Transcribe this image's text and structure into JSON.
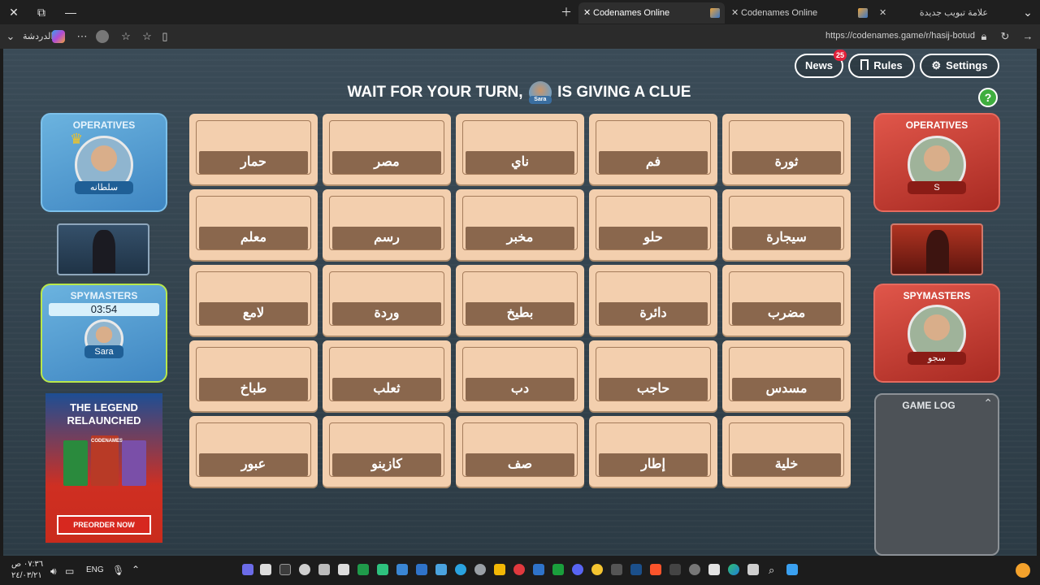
{
  "browser": {
    "tabs": [
      {
        "label": "Codenames Online",
        "active": true
      },
      {
        "label": "Codenames Online",
        "active": false
      },
      {
        "label": "علامة تبويب جديدة",
        "active": false
      }
    ],
    "chat_label": "الدردشة",
    "url": "https://codenames.game/r/hasij-botud"
  },
  "toolbar": {
    "news_label": "News",
    "news_count": "25",
    "rules_label": "Rules",
    "settings_label": "Settings"
  },
  "headline": {
    "before": "WAIT FOR YOUR TURN,",
    "player": "Sara",
    "after": "IS GIVING A CLUE"
  },
  "blue_team": {
    "operatives_title": "OPERATIVES",
    "operative_name": "سلطانه",
    "spymasters_title": "SPYMASTERS",
    "timer": "03:54",
    "spymaster_name": "Sara"
  },
  "red_team": {
    "operatives_title": "OPERATIVES",
    "operative_name": "S",
    "spymasters_title": "SPYMASTERS",
    "spymaster_name": "سجو"
  },
  "board": {
    "words": [
      "حمار",
      "مصر",
      "ناي",
      "فم",
      "ثورة",
      "معلم",
      "رسم",
      "مخبر",
      "حلو",
      "سيجارة",
      "لامع",
      "وردة",
      "بطيخ",
      "دائرة",
      "مضرب",
      "طباخ",
      "ثعلب",
      "دب",
      "حاجب",
      "مسدس",
      "عبور",
      "كازينو",
      "صف",
      "إطار",
      "خلية"
    ]
  },
  "promo": {
    "title_line1": "THE LEGEND",
    "title_line2": "RELAUNCHED",
    "box_label": "CODENAMES",
    "button_label": "PREORDER NOW"
  },
  "game_log": {
    "title": "GAME LOG"
  },
  "taskbar": {
    "time": "٠٧:٣٦ ص",
    "date": "٢٤/٠٣/٢١",
    "language": "ENG"
  },
  "colors": {
    "card": "#f3cfae",
    "word_band": "#8a674d",
    "blue_panel": "#4f99d2",
    "red_panel": "#c94236"
  }
}
